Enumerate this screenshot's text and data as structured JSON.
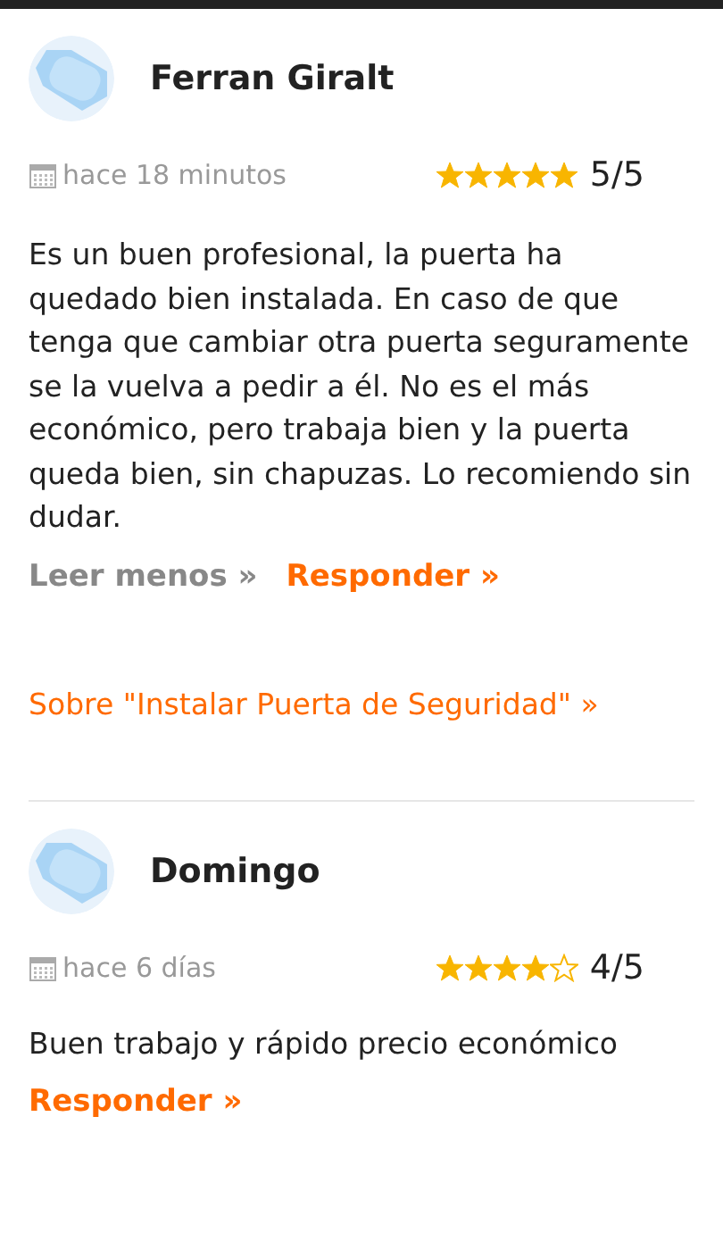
{
  "reviews": [
    {
      "name": "Ferran Giralt",
      "time": "hace 18 minutos",
      "stars": 5,
      "score": "5/5",
      "text": "Es un buen profesional, la puerta ha quedado bien instalada. En caso de que tenga que cambiar otra puerta seguramente se la vuelva a pedir a él. No es el más económico, pero trabaja bien y la puerta queda bien, sin chapuzas. Lo recomiendo sin dudar.",
      "links": [
        {
          "kind": "less",
          "label": "Leer menos »"
        },
        {
          "kind": "reply",
          "label": "Responder »"
        }
      ],
      "topic": "Sobre \"Instalar Puerta de Seguridad\" »"
    },
    {
      "name": "Domingo",
      "time": "hace 6 días",
      "stars": 4,
      "score": "4/5",
      "text": "Buen trabajo y rápido precio económico",
      "links": [
        {
          "kind": "reply",
          "label": "Responder »"
        }
      ]
    }
  ]
}
